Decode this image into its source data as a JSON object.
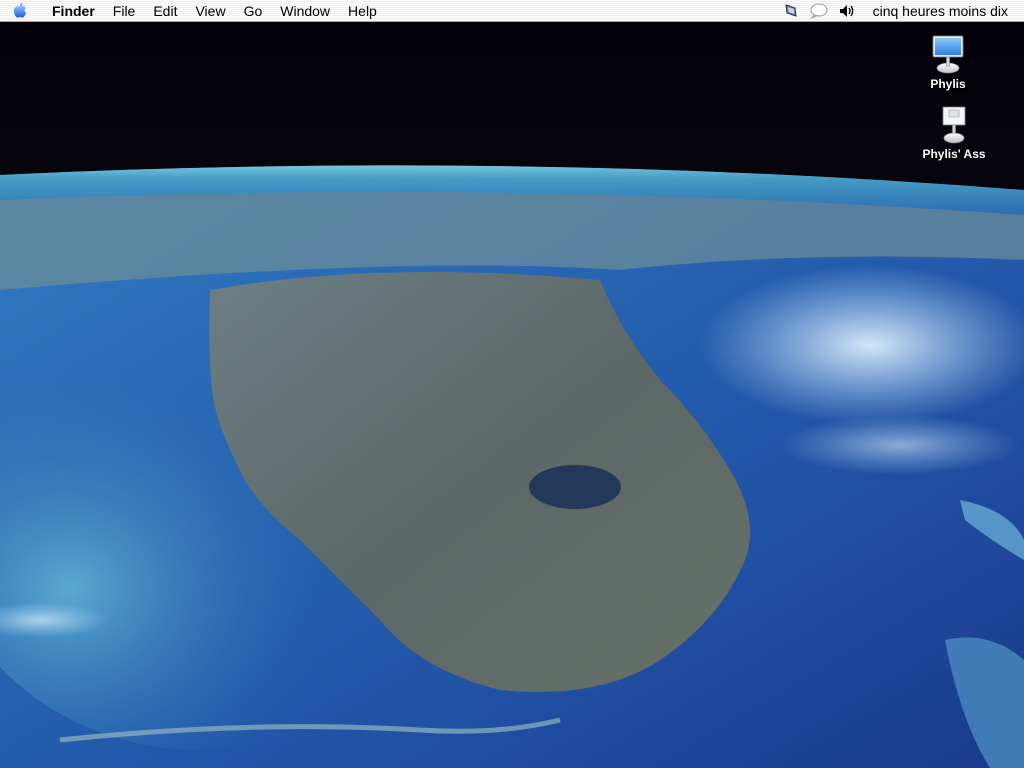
{
  "menubar": {
    "apple_icon": "apple-logo-icon",
    "app_name": "Finder",
    "items": [
      "File",
      "Edit",
      "View",
      "Go",
      "Window",
      "Help"
    ],
    "status_icons": [
      "eject-icon",
      "ichat-status-icon",
      "volume-icon"
    ],
    "clock": "cinq heures moins dix"
  },
  "desktop": {
    "icons": [
      {
        "label": "Phylis",
        "icon": "imac-icon"
      },
      {
        "label": "Phylis' Ass",
        "icon": "network-volume-icon"
      }
    ]
  },
  "colors": {
    "space": "#05030c",
    "ocean": "#2a5fa8",
    "land": "#5b6a6a",
    "lake": "#243a5c"
  }
}
